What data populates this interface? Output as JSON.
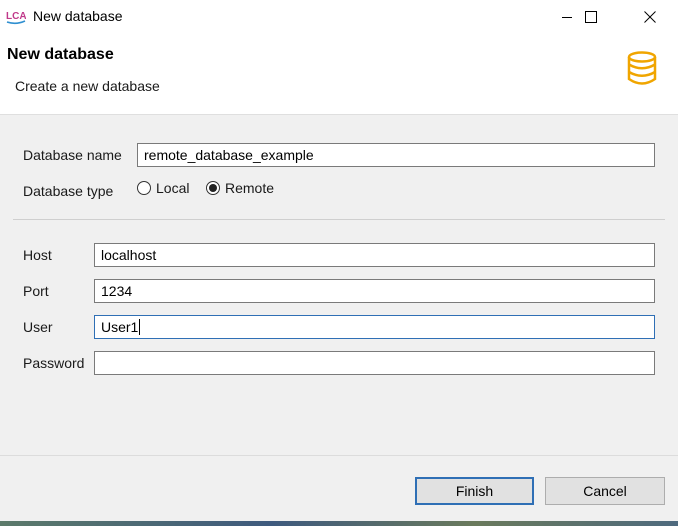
{
  "window": {
    "app_icon_text": "LCA",
    "title": "New database",
    "controls": [
      "minimize-icon",
      "maximize-icon",
      "close-icon"
    ]
  },
  "header": {
    "title": "New database",
    "subtitle": "Create a new database",
    "icon": "database-icon"
  },
  "form": {
    "database_name": {
      "label": "Database name",
      "value": "remote_database_example"
    },
    "database_type": {
      "label": "Database type",
      "options": [
        {
          "label": "Local",
          "selected": false
        },
        {
          "label": "Remote",
          "selected": true
        }
      ]
    },
    "host": {
      "label": "Host",
      "value": "localhost"
    },
    "port": {
      "label": "Port",
      "value": "1234"
    },
    "user": {
      "label": "User",
      "value": "User1"
    },
    "password": {
      "label": "Password",
      "value": ""
    }
  },
  "buttons": {
    "finish": "Finish",
    "cancel": "Cancel"
  },
  "colors": {
    "accent": "#2f6fb5",
    "db_icon": "#f0a500"
  }
}
